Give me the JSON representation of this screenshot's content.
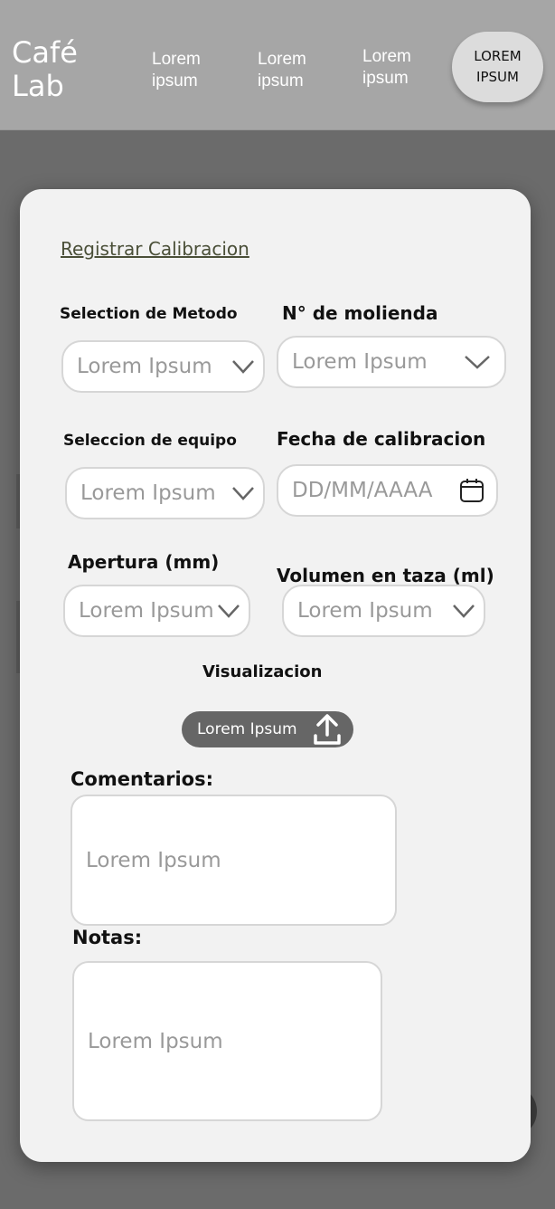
{
  "header": {
    "brand": "Café Lab",
    "nav": [
      "Lorem ipsum",
      "Lorem ipsum",
      "Lorem ipsum"
    ],
    "pill": "LOREM IPSUM"
  },
  "form": {
    "title": "Registrar Calibracion",
    "fields": {
      "metodo": {
        "label": "Selection de Metodo",
        "value": "Lorem Ipsum"
      },
      "molienda": {
        "label": "N° de molienda",
        "value": "Lorem Ipsum"
      },
      "equipo": {
        "label": "Seleccion de equipo",
        "value": "Lorem Ipsum"
      },
      "fecha": {
        "label": "Fecha de calibracion",
        "placeholder": "DD/MM/AAAA"
      },
      "apertura": {
        "label": "Apertura (mm)",
        "value": "Lorem Ipsum"
      },
      "volumen": {
        "label": "Volumen en taza (ml)",
        "value": "Lorem Ipsum"
      }
    },
    "visualizacion": {
      "label": "Visualizacion",
      "upload_label": "Lorem Ipsum"
    },
    "comentarios": {
      "label": "Comentarios:",
      "placeholder": "Lorem Ipsum"
    },
    "notas": {
      "label": "Notas:",
      "placeholder": "Lorem Ipsum"
    }
  },
  "icons": {
    "chevron": "chevron-down-icon",
    "calendar": "calendar-icon",
    "upload": "upload-icon"
  },
  "colors": {
    "header_bg": "#a6a6a6",
    "card_bg": "#f2f2f2",
    "button_bg": "#666666",
    "title_color": "#4a4f38"
  }
}
